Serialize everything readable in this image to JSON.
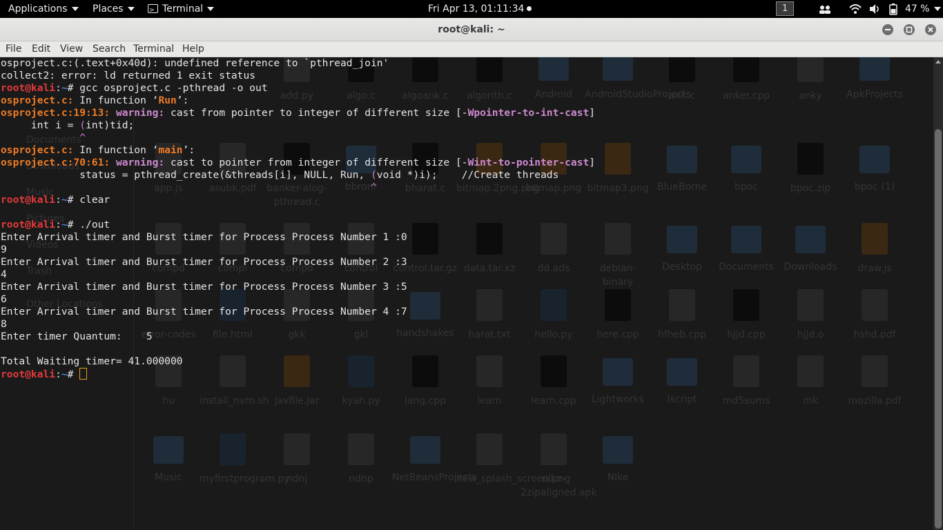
{
  "top_panel": {
    "applications": "Applications",
    "places": "Places",
    "terminal": "Terminal",
    "clock": "Fri Apr 13, 01:11:34",
    "workspace": "1",
    "battery": "47 %",
    "icons": [
      "people-icon",
      "wifi-icon",
      "volume-icon",
      "battery-icon"
    ]
  },
  "window": {
    "title": "root@kali: ~",
    "controls": [
      "minimize",
      "maximize",
      "close"
    ]
  },
  "menu": [
    "File",
    "Edit",
    "View",
    "Search",
    "Terminal",
    "Help"
  ],
  "terminal": {
    "lines": [
      [
        {
          "t": "osproject.c:(.text+0x40d): undefined reference to `pthread_join'"
        }
      ],
      [
        {
          "t": "collect2: error: ld returned 1 exit status"
        }
      ],
      [
        {
          "t": "root@kali",
          "c": "red"
        },
        {
          "t": ":"
        },
        {
          "t": "~",
          "c": "blue"
        },
        {
          "t": "# gcc osproject.c -pthread -o out"
        }
      ],
      [
        {
          "t": "osproject.c:",
          "c": "org"
        },
        {
          "t": " In function ‘"
        },
        {
          "t": "Run",
          "c": "org"
        },
        {
          "t": "’:"
        }
      ],
      [
        {
          "t": "osproject.c:19:13:",
          "c": "org"
        },
        {
          "t": " "
        },
        {
          "t": "warning:",
          "c": "pur"
        },
        {
          "t": " cast from pointer to integer of different size [-"
        },
        {
          "t": "Wpointer-to-int-cast",
          "c": "pur"
        },
        {
          "t": "]"
        }
      ],
      [
        {
          "t": "     int i = "
        },
        {
          "t": "(",
          "c": "pink"
        },
        {
          "t": "int)tid;"
        }
      ],
      [
        {
          "t": "             "
        },
        {
          "t": "^",
          "c": "pink"
        }
      ],
      [
        {
          "t": "osproject.c:",
          "c": "org"
        },
        {
          "t": " In function ‘"
        },
        {
          "t": "main",
          "c": "org"
        },
        {
          "t": "’:"
        }
      ],
      [
        {
          "t": "osproject.c:70:61:",
          "c": "org"
        },
        {
          "t": " "
        },
        {
          "t": "warning:",
          "c": "pur"
        },
        {
          "t": " cast to pointer from integer of different size [-"
        },
        {
          "t": "Wint-to-pointer-cast",
          "c": "pur"
        },
        {
          "t": "]"
        }
      ],
      [
        {
          "t": "             status = pthread_create(&threads[i], NULL, Run, "
        },
        {
          "t": "(",
          "c": "pink"
        },
        {
          "t": "void *)i);    //Create threads"
        }
      ],
      [
        {
          "t": "                                                             "
        },
        {
          "t": "^",
          "c": "pink"
        }
      ],
      [
        {
          "t": "root@kali",
          "c": "red"
        },
        {
          "t": ":"
        },
        {
          "t": "~",
          "c": "blue"
        },
        {
          "t": "# clear"
        }
      ],
      [
        {
          "t": ""
        }
      ],
      [
        {
          "t": "root@kali",
          "c": "red"
        },
        {
          "t": ":"
        },
        {
          "t": "~",
          "c": "blue"
        },
        {
          "t": "# ./out"
        }
      ],
      [
        {
          "t": "Enter Arrival timer and Burst timer for Process Process Number 1 :0"
        }
      ],
      [
        {
          "t": "9"
        }
      ],
      [
        {
          "t": "Enter Arrival timer and Burst timer for Process Process Number 2 :3"
        }
      ],
      [
        {
          "t": "4"
        }
      ],
      [
        {
          "t": "Enter Arrival timer and Burst timer for Process Process Number 3 :5"
        }
      ],
      [
        {
          "t": "6"
        }
      ],
      [
        {
          "t": "Enter Arrival timer and Burst timer for Process Process Number 4 :7"
        }
      ],
      [
        {
          "t": "8"
        }
      ],
      [
        {
          "t": "Enter timer Quantum:    5"
        }
      ],
      [
        {
          "t": ""
        }
      ],
      [
        {
          "t": "Total Waiting timer= 41.000000"
        }
      ],
      [
        {
          "t": "root@kali",
          "c": "red"
        },
        {
          "t": ":"
        },
        {
          "t": "~",
          "c": "blue"
        },
        {
          "t": "# "
        },
        {
          "cursor": true
        }
      ]
    ]
  },
  "desktop_behind": {
    "sidebar": [
      "Documents",
      "Downloads",
      "Music",
      "Pictures",
      "Videos",
      "Trash",
      "Other Locations"
    ],
    "files": [
      {
        "label": "add.py",
        "kind": "file"
      },
      {
        "label": "algo.c",
        "kind": "dark"
      },
      {
        "label": "algoank.c",
        "kind": "dark"
      },
      {
        "label": "algorith.c",
        "kind": "dark"
      },
      {
        "label": "Android",
        "kind": "folder"
      },
      {
        "label": "AndroidStudioProjects",
        "kind": "folder"
      },
      {
        "label": "ank.c",
        "kind": "dark"
      },
      {
        "label": "anker.cpp",
        "kind": "dark"
      },
      {
        "label": "anky",
        "kind": "file"
      },
      {
        "label": "ApkProjects",
        "kind": "folder"
      },
      {
        "label": "app.js",
        "kind": "file"
      },
      {
        "label": "asubk.pdf",
        "kind": "file"
      },
      {
        "label": "banker-alog-pthread.c",
        "kind": "dark"
      },
      {
        "label": "bbronr",
        "kind": "folder"
      },
      {
        "label": "bharat.c",
        "kind": "dark"
      },
      {
        "label": "bitmap.2png.png",
        "kind": "orange"
      },
      {
        "label": "bitmap.png",
        "kind": "orange"
      },
      {
        "label": "bitmap3.png",
        "kind": "orange"
      },
      {
        "label": "BlueBorne",
        "kind": "folder"
      },
      {
        "label": "bpoc",
        "kind": "folder"
      },
      {
        "label": "bpoc.zip",
        "kind": "dark"
      },
      {
        "label": "bpoc (1)",
        "kind": "folder"
      },
      {
        "label": "compd",
        "kind": "file"
      },
      {
        "label": "compi",
        "kind": "file"
      },
      {
        "label": "compo",
        "kind": "file"
      },
      {
        "label": "control",
        "kind": "file"
      },
      {
        "label": "control.tar.gz",
        "kind": "dark"
      },
      {
        "label": "data.tar.xz",
        "kind": "dark"
      },
      {
        "label": "dd.ads",
        "kind": "file"
      },
      {
        "label": "debian-binary",
        "kind": "file"
      },
      {
        "label": "Desktop",
        "kind": "folder"
      },
      {
        "label": "Documents",
        "kind": "folder"
      },
      {
        "label": "Downloads",
        "kind": "folder"
      },
      {
        "label": "draw.js",
        "kind": "orange"
      },
      {
        "label": "error-codes",
        "kind": "file"
      },
      {
        "label": "file.html",
        "kind": "py"
      },
      {
        "label": "gkk",
        "kind": "file"
      },
      {
        "label": "gkl",
        "kind": "file"
      },
      {
        "label": "handshakes",
        "kind": "folder"
      },
      {
        "label": "harat.txt",
        "kind": "file"
      },
      {
        "label": "hello.py",
        "kind": "py"
      },
      {
        "label": "here.cpp",
        "kind": "dark"
      },
      {
        "label": "hfheb.cpp",
        "kind": "file"
      },
      {
        "label": "hjjd.cpp",
        "kind": "dark"
      },
      {
        "label": "hjjd.o",
        "kind": "file"
      },
      {
        "label": "hshd.pdf",
        "kind": "file"
      },
      {
        "label": "hu",
        "kind": "file"
      },
      {
        "label": "install_nvm.sh",
        "kind": "file"
      },
      {
        "label": "javfile.jar",
        "kind": "orange"
      },
      {
        "label": "kyah.py",
        "kind": "py"
      },
      {
        "label": "lang.cpp",
        "kind": "dark"
      },
      {
        "label": "learn",
        "kind": "file"
      },
      {
        "label": "learn.cpp",
        "kind": "dark"
      },
      {
        "label": "Lightworks",
        "kind": "folder"
      },
      {
        "label": "lscript",
        "kind": "folder"
      },
      {
        "label": "md5sums",
        "kind": "file"
      },
      {
        "label": "mk",
        "kind": "file"
      },
      {
        "label": "mozilla.pdf",
        "kind": "file"
      },
      {
        "label": "Music",
        "kind": "folder"
      },
      {
        "label": "myfirstprogram.py",
        "kind": "py"
      },
      {
        "label": "ndnj",
        "kind": "file"
      },
      {
        "label": "ndnp",
        "kind": "file"
      },
      {
        "label": "NetBeansProjects",
        "kind": "folder"
      },
      {
        "label": "new_splash_screen.png",
        "kind": "file"
      },
      {
        "label": "nike-2zipaligned.apk",
        "kind": "file"
      },
      {
        "label": "NIke",
        "kind": "folder"
      }
    ]
  }
}
